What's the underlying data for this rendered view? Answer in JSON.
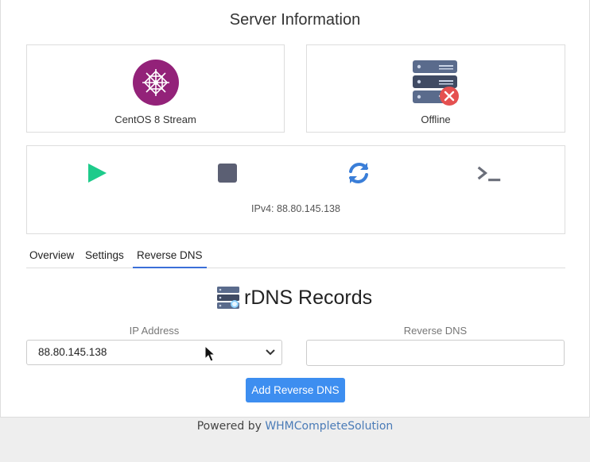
{
  "header": {
    "title": "Server Information"
  },
  "os": {
    "label": "CentOS 8 Stream",
    "icon": "centos-logo"
  },
  "status": {
    "label": "Offline",
    "icon": "server-offline-icon"
  },
  "actions": {
    "items": [
      "play-icon",
      "stop-icon",
      "restart-icon",
      "console-icon"
    ],
    "ip_line": "IPv4: 88.80.145.138"
  },
  "tabs": [
    {
      "label": "Overview",
      "active": false
    },
    {
      "label": "Settings",
      "active": false
    },
    {
      "label": "Reverse DNS",
      "active": true
    }
  ],
  "rdns": {
    "title": "rDNS Records",
    "ip_label": "IP Address",
    "ip_value": "88.80.145.138",
    "dns_label": "Reverse DNS",
    "dns_value": "",
    "add_button": "Add Reverse DNS"
  },
  "footer": {
    "prefix": "Powered by ",
    "link": "WHMCompleteSolution"
  },
  "colors": {
    "accent": "#3d8ef0",
    "play": "#1ecb8b",
    "stop": "#5b5f73",
    "restart": "#3a7ed8",
    "centos": "#932279",
    "offline": "#e55050"
  }
}
